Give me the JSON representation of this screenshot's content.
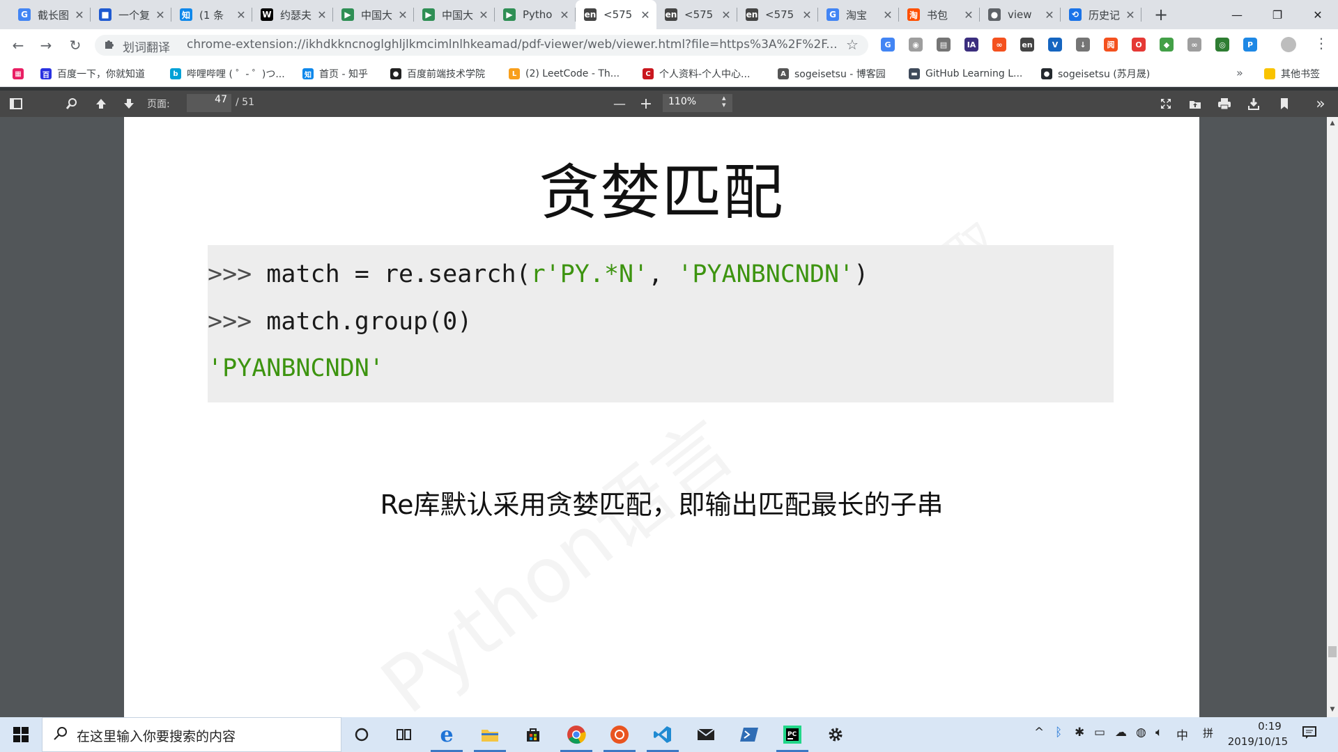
{
  "tabs": [
    {
      "title": "截长图",
      "icon": "G",
      "color": "#4285f4",
      "active": false
    },
    {
      "title": "一个复",
      "icon": "■",
      "color": "#1f5ad1",
      "active": false
    },
    {
      "title": "(1 条",
      "icon": "知",
      "color": "#0f88eb",
      "active": false
    },
    {
      "title": "约瑟夫",
      "icon": "W",
      "color": "#000000",
      "active": false
    },
    {
      "title": "中国大",
      "icon": "▶",
      "color": "#2f8f55",
      "active": false
    },
    {
      "title": "中国大",
      "icon": "▶",
      "color": "#2f8f55",
      "active": false
    },
    {
      "title": "Pytho",
      "icon": "▶",
      "color": "#2f8f55",
      "active": false
    },
    {
      "title": "<575",
      "icon": "en",
      "color": "#444444",
      "active": true
    },
    {
      "title": "<575",
      "icon": "en",
      "color": "#444444",
      "active": false
    },
    {
      "title": "<575",
      "icon": "en",
      "color": "#444444",
      "active": false
    },
    {
      "title": "淘宝",
      "icon": "G",
      "color": "#4285f4",
      "active": false
    },
    {
      "title": "书包",
      "icon": "淘",
      "color": "#ff5000",
      "active": false
    },
    {
      "title": "view",
      "icon": "●",
      "color": "#5f6368",
      "active": false
    },
    {
      "title": "历史记",
      "icon": "⟲",
      "color": "#1a73e8",
      "active": false
    }
  ],
  "tab_close": "✕",
  "new_tab": "+",
  "window_controls": {
    "minimize": "—",
    "restore": "❐",
    "close": "✕"
  },
  "nav": {
    "back": "←",
    "forward": "→",
    "reload": "↻"
  },
  "omnibox": {
    "ext_icon": "puzzle-icon",
    "ext_name": "划词翻译",
    "url": "chrome-extension://ikhdkkncnoglghljlkmcimlnlhkeamad/pdf-viewer/web/viewer.html?file=https%3A%2F%2F...",
    "star": "☆"
  },
  "extensions": [
    {
      "label": "G",
      "color": "#4285f4"
    },
    {
      "label": "◉",
      "color": "#9e9e9e"
    },
    {
      "label": "▤",
      "color": "#757575"
    },
    {
      "label": "IA",
      "color": "#3b2e7e"
    },
    {
      "label": "∞",
      "color": "#f4511e"
    },
    {
      "label": "en",
      "color": "#444444"
    },
    {
      "label": "V",
      "color": "#1565c0"
    },
    {
      "label": "↓",
      "color": "#757575"
    },
    {
      "label": "阅",
      "color": "#f4511e"
    },
    {
      "label": "O",
      "color": "#e53935"
    },
    {
      "label": "◆",
      "color": "#43a047"
    },
    {
      "label": "∞",
      "color": "#9e9e9e"
    },
    {
      "label": "◎",
      "color": "#2e7d32"
    },
    {
      "label": "P",
      "color": "#1e88e5"
    }
  ],
  "bookmarks": [
    {
      "label": "",
      "icon": "▦",
      "color": "#e91e63"
    },
    {
      "label": "百度一下，你就知道",
      "icon": "百",
      "color": "#2932e1"
    },
    {
      "label": "哔哩哔哩 ( ゜- ゜)つ...",
      "icon": "b",
      "color": "#00a1d6"
    },
    {
      "label": "首页 - 知乎",
      "icon": "知",
      "color": "#0f88eb"
    },
    {
      "label": "百度前端技术学院",
      "icon": "●",
      "color": "#222222"
    },
    {
      "label": "(2) LeetCode - Th...",
      "icon": "L",
      "color": "#f89f1b"
    },
    {
      "label": "个人资料-个人中心...",
      "icon": "C",
      "color": "#c9171e"
    },
    {
      "label": "sogeisetsu - 博客园",
      "icon": "A",
      "color": "#555555"
    },
    {
      "label": "GitHub Learning L...",
      "icon": "▬",
      "color": "#3f4b5b"
    },
    {
      "label": "sogeisetsu (苏月晟)",
      "icon": "●",
      "color": "#24292e"
    }
  ],
  "bookmarks_more": "»",
  "other_bookmarks": "其他书签",
  "pdf_toolbar": {
    "page_label": "页面:",
    "current_page": "47",
    "total_pages": "/ 51",
    "zoom": "110%",
    "zoom_out": "—",
    "zoom_in": "+"
  },
  "slide": {
    "title": "贪婪匹配",
    "code": {
      "line1": {
        "prompt": ">>> ",
        "code_a": "match = re.search(",
        "str_a": "r'PY.*N'",
        "code_b": ", ",
        "str_b": "'PYANBNCNDN'",
        "code_c": ")"
      },
      "line2": {
        "prompt": ">>> ",
        "code": "match.group(0)"
      },
      "line3": {
        "result": "'PYANBNCNDN'"
      }
    },
    "caption": "Re库默认采用贪婪匹配，即输出匹配最长的子串",
    "watermark_1": "Python语言",
    "watermark_2": "提取"
  },
  "taskbar": {
    "search_placeholder": "在这里输入你要搜索的内容",
    "apps": [
      "cortana-icon",
      "task-view-icon",
      "edge-icon",
      "file-explorer-icon",
      "store-icon",
      "chrome-icon",
      "ubuntu-icon",
      "vscode-icon",
      "mail-icon",
      "powershell-icon",
      "pycharm-icon",
      "settings-icon"
    ],
    "ime_mode": "中",
    "ime_layout": "拼",
    "time": "0:19",
    "date": "2019/10/15"
  }
}
